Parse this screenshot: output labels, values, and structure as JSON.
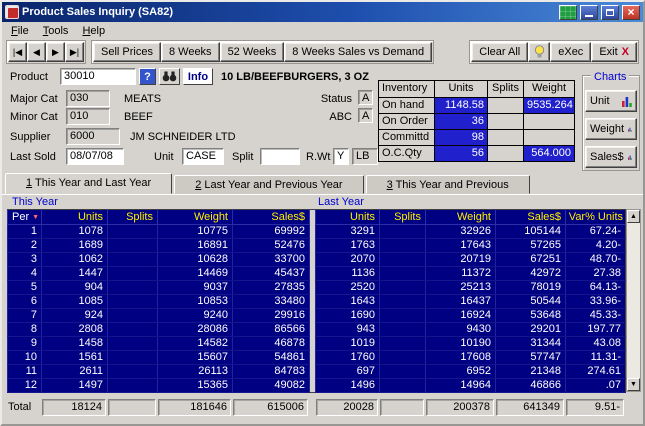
{
  "window": {
    "title": "Product Sales Inquiry  (SA82)",
    "menu": [
      "File",
      "Tools",
      "Help"
    ]
  },
  "icons": {
    "filter": "▼",
    "scroll_up": "▲",
    "scroll_down": "▼",
    "close": "×",
    "help": "?"
  },
  "toolbar": {
    "nav_first": "|◀",
    "nav_prev": "◀",
    "nav_next": "▶",
    "nav_last": "▶|",
    "sell_prices": "Sell Prices",
    "weeks8": "8 Weeks",
    "weeks52": "52 Weeks",
    "sales_vs_demand": "8 Weeks Sales vs Demand",
    "clear_all": "Clear All",
    "exec": "eXec",
    "exit": "Exit",
    "exit_x": "X"
  },
  "form": {
    "product": {
      "label": "Product",
      "value": "30010",
      "desc": "10 LB/BEEFBURGERS, 3 OZ",
      "info": "Info"
    },
    "major_cat": {
      "label": "Major Cat",
      "value": "030",
      "desc": "MEATS"
    },
    "minor_cat": {
      "label": "Minor Cat",
      "value": "010",
      "desc": "BEEF"
    },
    "supplier": {
      "label": "Supplier",
      "value": "6000",
      "desc": "JM SCHNEIDER LTD"
    },
    "last_sold": {
      "label": "Last Sold",
      "value": "08/07/08"
    },
    "unit": {
      "label": "Unit",
      "value": "CASE"
    },
    "split": {
      "label": "Split",
      "value": ""
    },
    "rwt": {
      "label": "R.Wt",
      "value": "Y",
      "uom": "LB"
    },
    "status": {
      "label": "Status",
      "value": "A"
    },
    "abc": {
      "label": "ABC",
      "value": "A"
    }
  },
  "inventory": {
    "title": "Inventory",
    "col_units": "Units",
    "col_splits": "Splits",
    "col_weight": "Weight",
    "rows": [
      {
        "label": "On hand",
        "units": "1148.58",
        "weight": "9535.264"
      },
      {
        "label": "On Order",
        "units": "36",
        "weight": ""
      },
      {
        "label": "Committd",
        "units": "98",
        "weight": ""
      },
      {
        "label": "O.C.Qty",
        "units": "56",
        "weight": "564.000"
      }
    ]
  },
  "charts": {
    "title": "Charts",
    "unit": "Unit",
    "weight": "Weight",
    "sales": "Sales$"
  },
  "tabs": [
    {
      "num": "1",
      "label": " This Year and Last Year"
    },
    {
      "num": "2",
      "label": " Last Year and Previous Year"
    },
    {
      "num": "3",
      "label": " This Year and Previous"
    }
  ],
  "table": {
    "group_left": "This Year",
    "group_right": "Last Year",
    "per_header": "Per",
    "h": {
      "units": "Units",
      "splits": "Splits",
      "weight": "Weight",
      "sales": "Sales$",
      "var": "Var% Units"
    },
    "rows": [
      {
        "per": "1",
        "ty_units": "1078",
        "ty_weight": "10775",
        "ty_sales": "69992",
        "ly_units": "3291",
        "ly_weight": "32926",
        "ly_sales": "105144",
        "var": "67.24-"
      },
      {
        "per": "2",
        "ty_units": "1689",
        "ty_weight": "16891",
        "ty_sales": "52476",
        "ly_units": "1763",
        "ly_weight": "17643",
        "ly_sales": "57265",
        "var": "4.20-"
      },
      {
        "per": "3",
        "ty_units": "1062",
        "ty_weight": "10628",
        "ty_sales": "33700",
        "ly_units": "2070",
        "ly_weight": "20719",
        "ly_sales": "67251",
        "var": "48.70-"
      },
      {
        "per": "4",
        "ty_units": "1447",
        "ty_weight": "14469",
        "ty_sales": "45437",
        "ly_units": "1136",
        "ly_weight": "11372",
        "ly_sales": "42972",
        "var": "27.38"
      },
      {
        "per": "5",
        "ty_units": "904",
        "ty_weight": "9037",
        "ty_sales": "27835",
        "ly_units": "2520",
        "ly_weight": "25213",
        "ly_sales": "78019",
        "var": "64.13-"
      },
      {
        "per": "6",
        "ty_units": "1085",
        "ty_weight": "10853",
        "ty_sales": "33480",
        "ly_units": "1643",
        "ly_weight": "16437",
        "ly_sales": "50544",
        "var": "33.96-"
      },
      {
        "per": "7",
        "ty_units": "924",
        "ty_weight": "9240",
        "ty_sales": "29916",
        "ly_units": "1690",
        "ly_weight": "16924",
        "ly_sales": "53648",
        "var": "45.33-"
      },
      {
        "per": "8",
        "ty_units": "2808",
        "ty_weight": "28086",
        "ty_sales": "86566",
        "ly_units": "943",
        "ly_weight": "9430",
        "ly_sales": "29201",
        "var": "197.77"
      },
      {
        "per": "9",
        "ty_units": "1458",
        "ty_weight": "14582",
        "ty_sales": "46878",
        "ly_units": "1019",
        "ly_weight": "10190",
        "ly_sales": "31344",
        "var": "43.08"
      },
      {
        "per": "10",
        "ty_units": "1561",
        "ty_weight": "15607",
        "ty_sales": "54861",
        "ly_units": "1760",
        "ly_weight": "17608",
        "ly_sales": "57747",
        "var": "11.31-"
      },
      {
        "per": "11",
        "ty_units": "2611",
        "ty_weight": "26113",
        "ty_sales": "84783",
        "ly_units": "697",
        "ly_weight": "6952",
        "ly_sales": "21348",
        "var": "274.61"
      },
      {
        "per": "12",
        "ty_units": "1497",
        "ty_weight": "15365",
        "ty_sales": "49082",
        "ly_units": "1496",
        "ly_weight": "14964",
        "ly_sales": "46866",
        "var": ".07"
      }
    ],
    "totals": {
      "label": "Total",
      "ty_units": "18124",
      "ty_weight": "181646",
      "ty_sales": "615006",
      "ly_units": "20028",
      "ly_weight": "200378",
      "ly_sales": "641349",
      "var": "9.51-"
    }
  }
}
